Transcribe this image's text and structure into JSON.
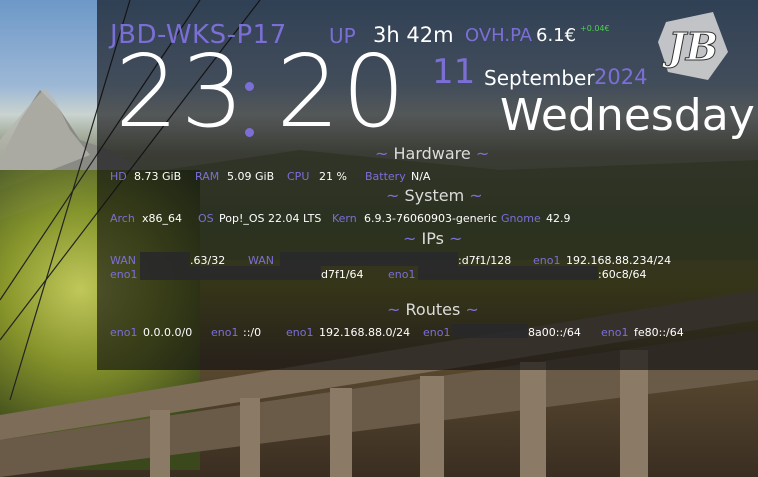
{
  "host": "JBD-WKS-P17",
  "clock": {
    "hours": "23",
    "minutes": "20"
  },
  "uptime": {
    "label": "UP",
    "value": "3h 42m"
  },
  "stock": {
    "symbol": "OVH.PA",
    "price": "6.1€",
    "change": "+0.04€"
  },
  "date": {
    "day": "11",
    "month": "September",
    "year": "2024",
    "weekday": "Wednesday"
  },
  "logo_text": "JB",
  "sections": {
    "hardware": "Hardware",
    "system": "System",
    "ips": "IPs",
    "routes": "Routes",
    "tilde": "~"
  },
  "hardware": {
    "hd_label": "HD",
    "hd_value": "8.73 GiB",
    "ram_label": "RAM",
    "ram_value": "5.09 GiB",
    "cpu_label": "CPU",
    "cpu_value": "21 %",
    "battery_label": "Battery",
    "battery_value": "N/A"
  },
  "system": {
    "arch_label": "Arch",
    "arch_value": "x86_64",
    "os_label": "OS",
    "os_value": "Pop!_OS 22.04 LTS",
    "kern_label": "Kern",
    "kern_value": "6.9.3-76060903-generic",
    "gnome_label": "Gnome",
    "gnome_value": "42.9"
  },
  "ips": {
    "wan1_label": "WAN",
    "wan1_value": ".63/32",
    "wan2_label": "WAN",
    "wan2_value": ":d7f1/128",
    "eno1a_label": "eno1",
    "eno1a_value": "192.168.88.234/24",
    "eno1b_label": "eno1",
    "eno1b_value": "d7f1/64",
    "eno1c_label": "eno1",
    "eno1c_value": ":60c8/64"
  },
  "routes": [
    {
      "label": "eno1",
      "value": "0.0.0.0/0"
    },
    {
      "label": "eno1",
      "value": "::/0"
    },
    {
      "label": "eno1",
      "value": "192.168.88.0/24"
    },
    {
      "label": "eno1",
      "value": "8a00::/64"
    },
    {
      "label": "eno1",
      "value": "fe80::/64"
    }
  ],
  "colors": {
    "accent": "#7b6fd6",
    "text": "#ffffff",
    "positive": "#4fd04f"
  }
}
